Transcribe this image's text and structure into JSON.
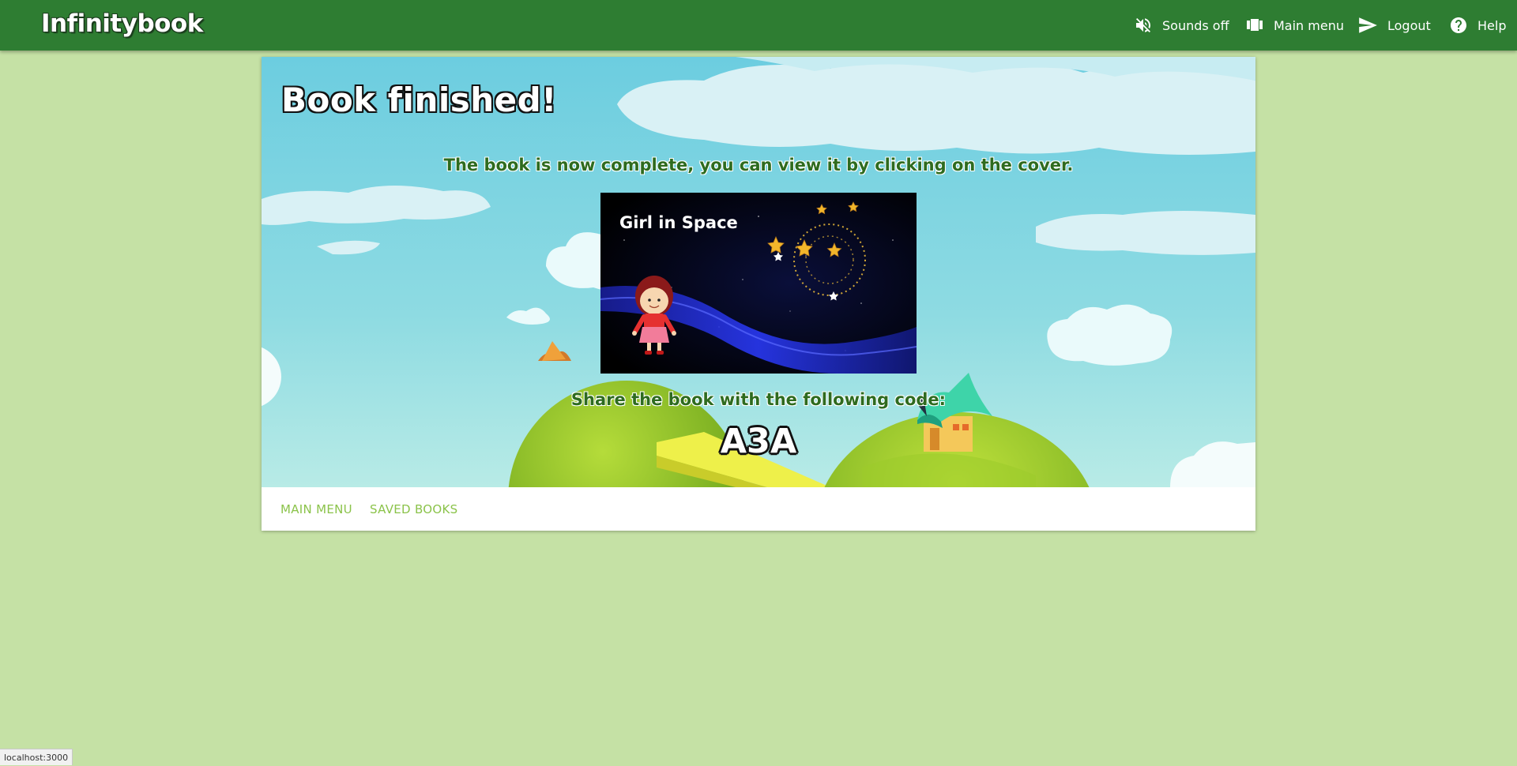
{
  "header": {
    "brand": "Infinitybook",
    "nav": {
      "sounds_label": "Sounds off",
      "menu_label": "Main menu",
      "logout_label": "Logout",
      "help_label": "Help"
    },
    "icons": {
      "sounds": "volume-off-icon",
      "menu": "view-carousel-icon",
      "logout": "send-icon",
      "help": "help-circle-icon"
    }
  },
  "main": {
    "title": "Book finished!",
    "message": "The book is now complete, you can view it by clicking on the cover.",
    "cover": {
      "title": "Girl in Space"
    },
    "share_text": "Share the book with the following code:",
    "code": "A3A"
  },
  "actions": {
    "main_menu": "MAIN MENU",
    "saved_books": "SAVED BOOKS"
  },
  "status": {
    "url": "localhost:3000"
  },
  "colors": {
    "appbar": "#2e7d32",
    "page_bg": "#c5e1a5",
    "action_text": "#8bc34a",
    "message_text": "#2e6b1f"
  }
}
